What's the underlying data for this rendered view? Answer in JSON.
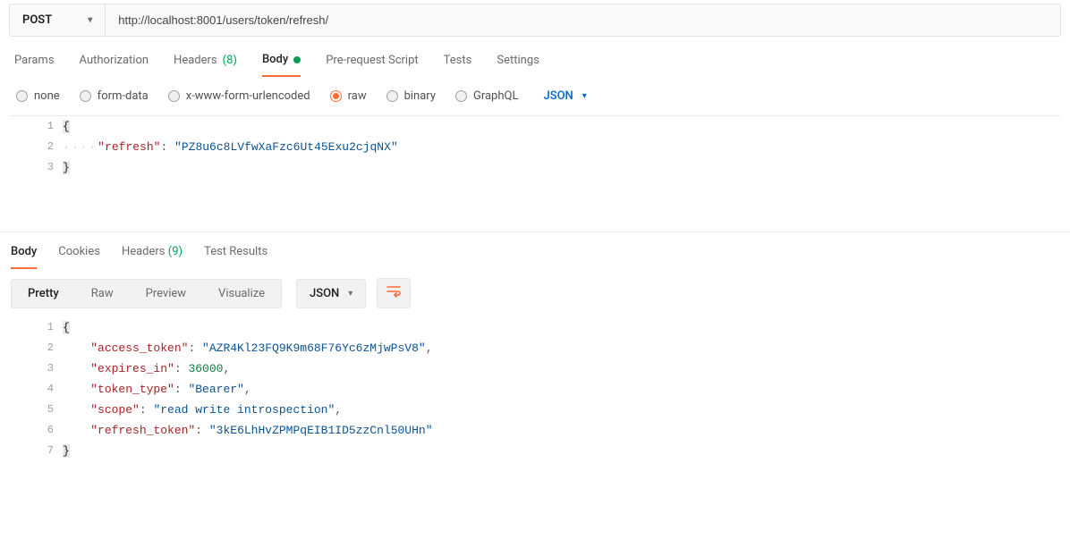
{
  "request": {
    "method": "POST",
    "url": "http://localhost:8001/users/token/refresh/"
  },
  "request_tabs": {
    "params": "Params",
    "authorization": "Authorization",
    "headers_label": "Headers",
    "headers_count": "(8)",
    "body": "Body",
    "prerequest": "Pre-request Script",
    "tests": "Tests",
    "settings": "Settings"
  },
  "body_types": {
    "none": "none",
    "form_data": "form-data",
    "xwww": "x-www-form-urlencoded",
    "raw": "raw",
    "binary": "binary",
    "graphql": "GraphQL",
    "content_type": "JSON"
  },
  "request_body": {
    "lines": [
      {
        "n": "1",
        "brace": "{"
      },
      {
        "n": "2",
        "key": "\"refresh\"",
        "colon": ": ",
        "val": "\"PZ8u6c8LVfwXaFzc6Ut45Exu2cjqNX\""
      },
      {
        "n": "3",
        "brace": "}"
      }
    ]
  },
  "response_tabs": {
    "body": "Body",
    "cookies": "Cookies",
    "headers_label": "Headers",
    "headers_count": "(9)",
    "test_results": "Test Results"
  },
  "response_toolbar": {
    "pretty": "Pretty",
    "raw": "Raw",
    "preview": "Preview",
    "visualize": "Visualize",
    "format": "JSON"
  },
  "response_body": {
    "lines": [
      {
        "n": "1",
        "brace": "{"
      },
      {
        "n": "2",
        "key": "\"access_token\"",
        "val": "\"AZR4Kl23FQ9K9m68F76Yc6zMjwPsV8\"",
        "comma": ","
      },
      {
        "n": "3",
        "key": "\"expires_in\"",
        "num": "36000",
        "comma": ","
      },
      {
        "n": "4",
        "key": "\"token_type\"",
        "val": "\"Bearer\"",
        "comma": ","
      },
      {
        "n": "5",
        "key": "\"scope\"",
        "val": "\"read write introspection\"",
        "comma": ","
      },
      {
        "n": "6",
        "key": "\"refresh_token\"",
        "val": "\"3kE6LhHvZPMPqEIB1ID5zzCnl50UHn\""
      },
      {
        "n": "7",
        "brace": "}"
      }
    ]
  }
}
